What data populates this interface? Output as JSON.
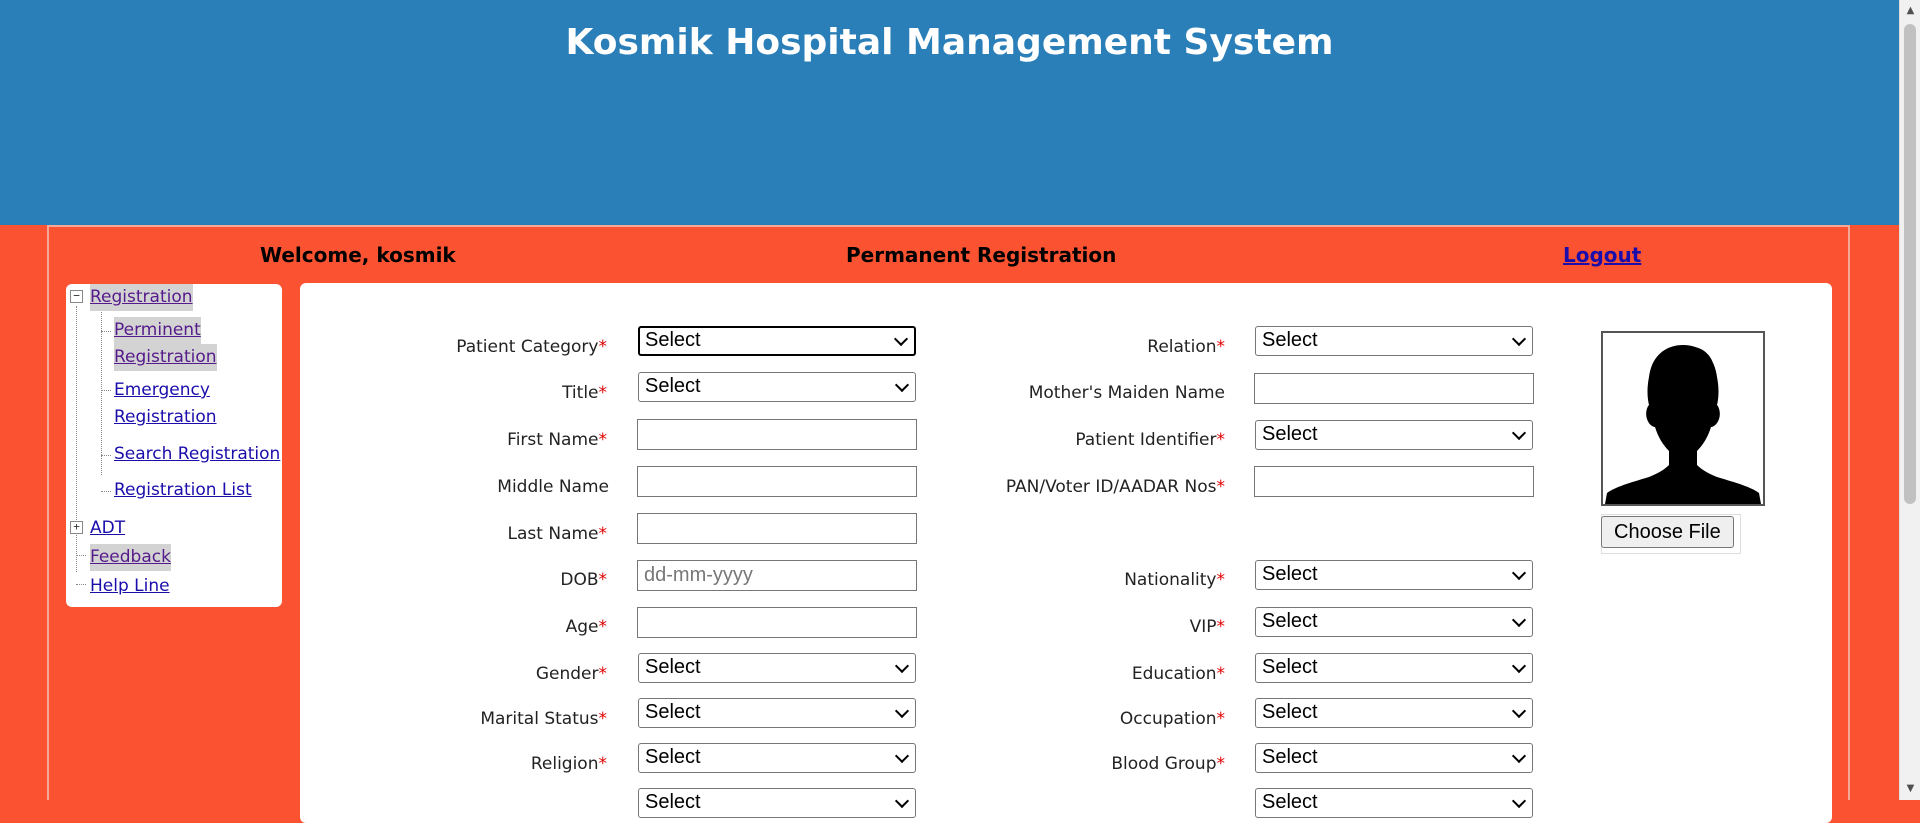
{
  "app": {
    "title": "Kosmik Hospital Management System"
  },
  "topbar": {
    "welcome": "Welcome, kosmik",
    "page_title": "Permanent Registration",
    "logout": "Logout"
  },
  "sidebar": {
    "registration": "Registration",
    "perminent": "Perminent",
    "perminent_reg": "Registration",
    "emergency": "Emergency",
    "emergency_reg": "Registration",
    "search_registration": "Search Registration",
    "registration_list": "Registration List",
    "adt": "ADT",
    "feedback": "Feedback",
    "help_line": "Help Line"
  },
  "form": {
    "patient_category": {
      "label": "Patient Category",
      "value": "Select"
    },
    "title": {
      "label": "Title",
      "value": "Select"
    },
    "first_name": {
      "label": "First Name",
      "value": ""
    },
    "middle_name": {
      "label": "Middle Name",
      "value": ""
    },
    "last_name": {
      "label": "Last Name",
      "value": ""
    },
    "dob": {
      "label": "DOB",
      "placeholder": "dd-mm-yyyy"
    },
    "age": {
      "label": "Age",
      "value": ""
    },
    "gender": {
      "label": "Gender",
      "value": "Select"
    },
    "marital_status": {
      "label": "Marital Status",
      "value": "Select"
    },
    "religion": {
      "label": "Religion",
      "value": "Select"
    },
    "extra_left": {
      "value": "Select"
    },
    "relation": {
      "label": "Relation",
      "value": "Select"
    },
    "mothers_maiden_name": {
      "label": "Mother's Maiden Name",
      "value": ""
    },
    "patient_identifier": {
      "label": "Patient Identifier",
      "value": "Select"
    },
    "pan_voter_aadar": {
      "label": "PAN/Voter ID/AADAR Nos",
      "value": ""
    },
    "nationality": {
      "label": "Nationality",
      "value": "Select"
    },
    "vip": {
      "label": "VIP",
      "value": "Select"
    },
    "education": {
      "label": "Education",
      "value": "Select"
    },
    "occupation": {
      "label": "Occupation",
      "value": "Select"
    },
    "blood_group": {
      "label": "Blood Group",
      "value": "Select"
    },
    "extra_right": {
      "value": "Select"
    },
    "required_mark": "*"
  },
  "photo": {
    "choose_file": "Choose File"
  },
  "colors": {
    "header_blue": "#2a7fb8",
    "page_orange": "#fb5331",
    "required_red": "#e00000",
    "link_blue": "#1a0dab"
  }
}
